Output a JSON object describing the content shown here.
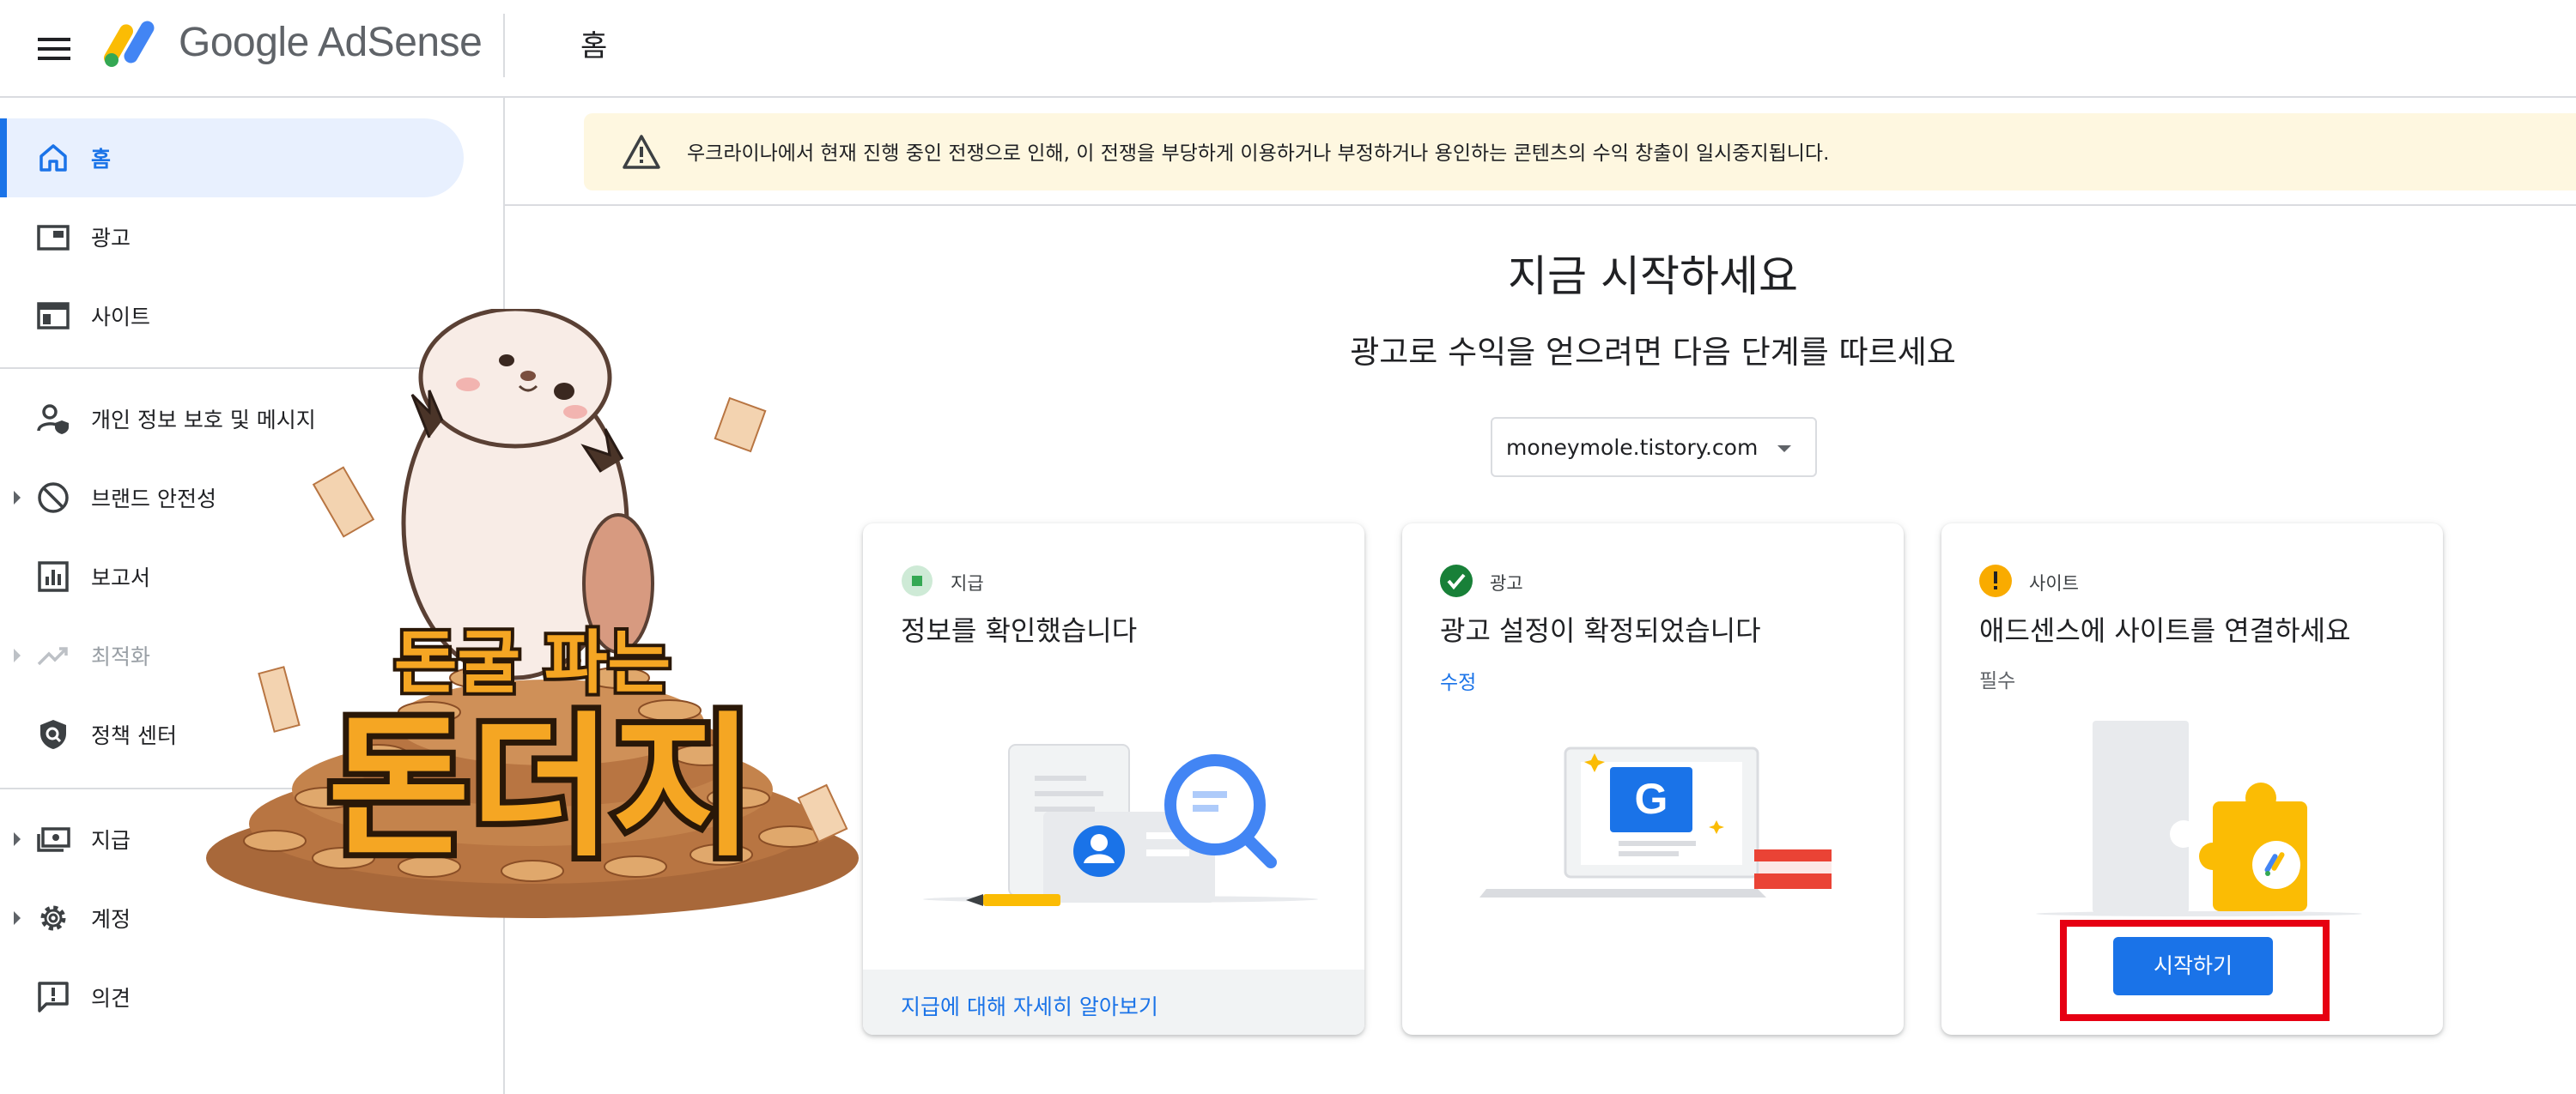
{
  "app": {
    "logo_text": "Google AdSense",
    "page_title": "홈"
  },
  "sidebar": {
    "items": [
      {
        "label": "홈",
        "icon": "home-icon"
      },
      {
        "label": "광고",
        "icon": "ads-icon"
      },
      {
        "label": "사이트",
        "icon": "sites-icon"
      },
      {
        "label": "개인 정보 보호 및 메시지",
        "icon": "privacy-icon"
      },
      {
        "label": "브랜드 안전성",
        "icon": "block-icon"
      },
      {
        "label": "보고서",
        "icon": "reports-icon"
      },
      {
        "label": "최적화",
        "icon": "trending-icon"
      },
      {
        "label": "정책 센터",
        "icon": "policy-icon"
      },
      {
        "label": "지급",
        "icon": "payments-icon"
      },
      {
        "label": "계정",
        "icon": "gear-icon"
      },
      {
        "label": "의견",
        "icon": "feedback-icon"
      }
    ]
  },
  "banner": {
    "text": "우크라이나에서 현재 진행 중인 전쟁으로 인해, 이 전쟁을 부당하게 이용하거나 부정하거나 용인하는 콘텐츠의 수익 창출이 일시중지됩니다."
  },
  "main": {
    "heading": "지금 시작하세요",
    "subheading": "광고로 수익을 얻으려면 다음 단계를 따르세요",
    "site_select": "moneymole.tistory.com"
  },
  "cards": [
    {
      "category": "지급",
      "title": "정보를 확인했습니다",
      "footer_link": "지급에 대해 자세히 알아보기"
    },
    {
      "category": "광고",
      "title": "광고 설정이 확정되었습니다",
      "action": "수정"
    },
    {
      "category": "사이트",
      "title": "애드센스에 사이트를 연결하세요",
      "note": "필수",
      "button": "시작하기"
    }
  ],
  "overlay": {
    "line1": "돈굴 파는",
    "line2": "돈더지"
  },
  "colors": {
    "accent": "#1a73e8",
    "banner_bg": "#fef7e0",
    "success": "#188038",
    "warning": "#f9ab00",
    "highlight": "#e60012"
  }
}
